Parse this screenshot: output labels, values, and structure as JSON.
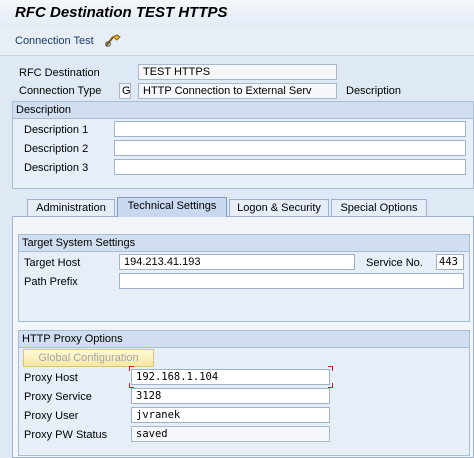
{
  "window": {
    "title": "RFC Destination TEST HTTPS"
  },
  "toolbar": {
    "connection_test_label": "Connection Test",
    "icon": "glasses-icon"
  },
  "header_fields": {
    "rfc_destination_label": "RFC Destination",
    "rfc_destination_value": "TEST HTTPS",
    "connection_type_label": "Connection Type",
    "connection_type_code": "G",
    "connection_type_value": "HTTP Connection to External Serv",
    "description_label": "Description"
  },
  "description_group": {
    "title": "Description",
    "fields": [
      {
        "label": "Description 1",
        "value": ""
      },
      {
        "label": "Description 2",
        "value": ""
      },
      {
        "label": "Description 3",
        "value": ""
      }
    ]
  },
  "tabs": [
    {
      "label": "Administration",
      "active": false
    },
    {
      "label": "Technical Settings",
      "active": true
    },
    {
      "label": "Logon & Security",
      "active": false
    },
    {
      "label": "Special Options",
      "active": false
    }
  ],
  "target_system": {
    "title": "Target System Settings",
    "target_host_label": "Target Host",
    "target_host_value": "194.213.41.193",
    "service_no_label": "Service No.",
    "service_no_value": "443",
    "path_prefix_label": "Path Prefix",
    "path_prefix_value": ""
  },
  "http_proxy": {
    "title": "HTTP Proxy Options",
    "global_config_button": "Global Configuration",
    "proxy_host_label": "Proxy Host",
    "proxy_host_value": "192.168.1.104",
    "proxy_service_label": "Proxy Service",
    "proxy_service_value": "3128",
    "proxy_user_label": "Proxy User",
    "proxy_user_value": "jvranek",
    "proxy_pw_status_label": "Proxy PW Status",
    "proxy_pw_status_value": "saved"
  },
  "colors": {
    "background": "#dfe9f5",
    "focus_marker": "#d02020",
    "button_yellow": "#f7e7a0"
  }
}
